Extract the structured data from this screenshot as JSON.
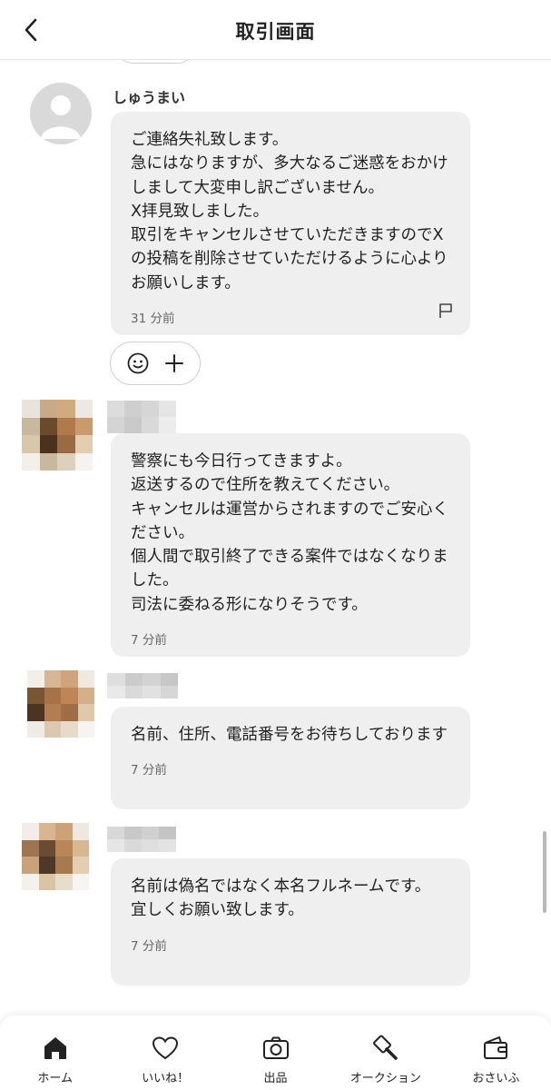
{
  "header": {
    "title": "取引画面"
  },
  "messages": [
    {
      "sender": "しゅうまい",
      "text": "ご連絡失礼致します。\n急にはなりますが、多大なるご迷惑をおかけしまして大変申し訳ございません。\nX拝見致しました。\n取引をキャンセルさせていただきますのでXの投稿を削除させていただけるように心よりお願いします。",
      "time": "31 分前"
    },
    {
      "sender": "",
      "text": "警察にも今日行ってきますよ。\n返送するので住所を教えてください。\nキャンセルは運営からされますのでご安心ください。\n個人間で取引終了できる案件ではなくなりました。\n司法に委ねる形になりそうです。",
      "time": "7 分前"
    },
    {
      "sender": "",
      "text": "名前、住所、電話番号をお待ちしております",
      "time": "7 分前"
    },
    {
      "sender": "",
      "text": "名前は偽名ではなく本名フルネームです。\n宜しくお願い致します。",
      "time": "7 分前"
    }
  ],
  "tabs": [
    {
      "label": "ホーム",
      "icon": "home-icon"
    },
    {
      "label": "いいね！",
      "icon": "heart-icon"
    },
    {
      "label": "出品",
      "icon": "camera-icon"
    },
    {
      "label": "オークション",
      "icon": "gavel-icon"
    },
    {
      "label": "おさいふ",
      "icon": "wallet-icon"
    }
  ],
  "colors": {
    "bubble": "#efefef",
    "avatar_default": "#d9d9d9",
    "text": "#222222"
  }
}
